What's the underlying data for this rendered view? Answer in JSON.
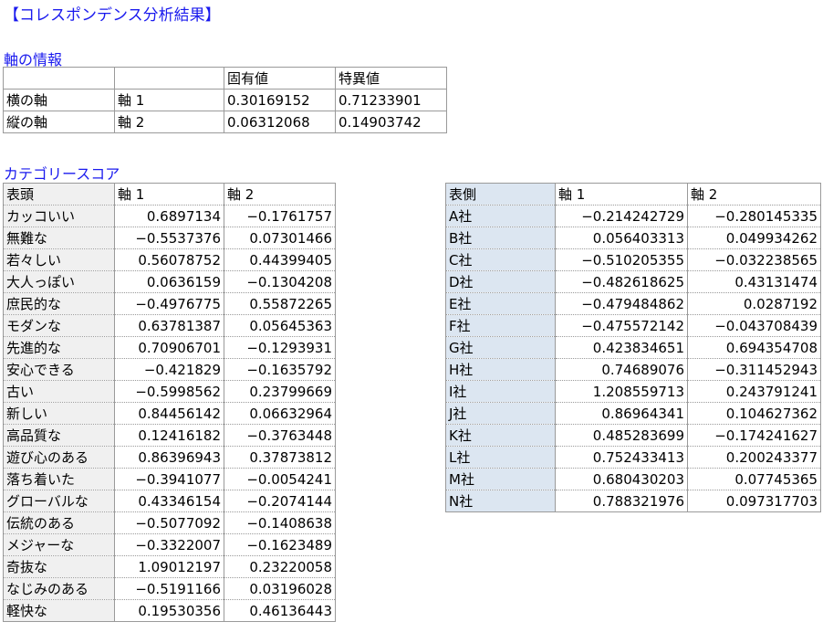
{
  "title": "【コレスポンデンス分析結果】",
  "axis_info": {
    "label": "軸の情報",
    "headers": [
      "",
      "",
      "固有値",
      "特異値"
    ],
    "rows": [
      [
        "横の軸",
        "軸 1",
        "0.30169152",
        "0.71233901"
      ],
      [
        "縦の軸",
        "軸 2",
        "0.06312068",
        "0.14903742"
      ]
    ]
  },
  "category_scores": {
    "label": "カテゴリースコア",
    "headers": [
      "表頭",
      "軸 1",
      "軸 2"
    ],
    "rows": [
      [
        "カッコいい",
        "0.6897134",
        "−0.1761757"
      ],
      [
        "無難な",
        "−0.5537376",
        "0.07301466"
      ],
      [
        "若々しい",
        "0.56078752",
        "0.44399405"
      ],
      [
        "大人っぽい",
        "0.0636159",
        "−0.1304208"
      ],
      [
        "庶民的な",
        "−0.4976775",
        "0.55872265"
      ],
      [
        "モダンな",
        "0.63781387",
        "0.05645363"
      ],
      [
        "先進的な",
        "0.70906701",
        "−0.1293931"
      ],
      [
        "安心できる",
        "−0.421829",
        "−0.1635792"
      ],
      [
        "古い",
        "−0.5998562",
        "0.23799669"
      ],
      [
        "新しい",
        "0.84456142",
        "0.06632964"
      ],
      [
        "高品質な",
        "0.12416182",
        "−0.3763448"
      ],
      [
        "遊び心のある",
        "0.86396943",
        "0.37873812"
      ],
      [
        "落ち着いた",
        "−0.3941077",
        "−0.0054241"
      ],
      [
        "グローバルな",
        "0.43346154",
        "−0.2074144"
      ],
      [
        "伝統のある",
        "−0.5077092",
        "−0.1408638"
      ],
      [
        "メジャーな",
        "−0.3322007",
        "−0.1623489"
      ],
      [
        "奇抜な",
        "1.09012197",
        "0.23220058"
      ],
      [
        "なじみのある",
        "−0.5191166",
        "0.03196028"
      ],
      [
        "軽快な",
        "0.19530356",
        "0.46136443"
      ]
    ]
  },
  "side_scores": {
    "headers": [
      "表側",
      "軸 1",
      "軸 2"
    ],
    "rows": [
      [
        "A社",
        "−0.214242729",
        "−0.280145335"
      ],
      [
        "B社",
        "0.056403313",
        "0.049934262"
      ],
      [
        "C社",
        "−0.510205355",
        "−0.032238565"
      ],
      [
        "D社",
        "−0.482618625",
        "0.43131474"
      ],
      [
        "E社",
        "−0.479484862",
        "0.0287192"
      ],
      [
        "F社",
        "−0.475572142",
        "−0.043708439"
      ],
      [
        "G社",
        "0.423834651",
        "0.694354708"
      ],
      [
        "H社",
        "0.74689076",
        "−0.311452943"
      ],
      [
        "I社",
        "1.208559713",
        "0.243791241"
      ],
      [
        "J社",
        "0.86964341",
        "0.104627362"
      ],
      [
        "K社",
        "0.485283699",
        "−0.174241627"
      ],
      [
        "L社",
        "0.752433413",
        "0.200243377"
      ],
      [
        "M社",
        "0.680430203",
        "0.07745365"
      ],
      [
        "N社",
        "0.788321976",
        "0.097317703"
      ]
    ]
  }
}
